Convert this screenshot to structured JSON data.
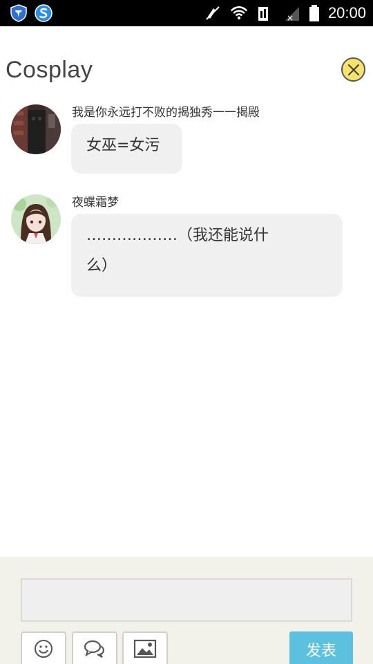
{
  "status_bar": {
    "time": "20:00",
    "icons": [
      "shield-app-icon",
      "sogou-app-icon",
      "mute-icon",
      "wifi-icon",
      "data-icon",
      "signal-icon",
      "battery-icon"
    ]
  },
  "header": {
    "title": "Cosplay",
    "close_icon": "close-icon",
    "close_color": "#f6e46a"
  },
  "messages": [
    {
      "username": "我是你永远打不败的揭独秀一一揭殿",
      "text": "女巫=女污",
      "avatar": "dark-avatar"
    },
    {
      "username": "夜蝶霜梦",
      "text_line1": "………………（我还能说什",
      "text_line2": "么）",
      "avatar": "anime-girl-avatar"
    }
  ],
  "composer": {
    "input_value": "",
    "tools": [
      "emoji-icon",
      "chat-bubbles-icon",
      "image-icon"
    ],
    "send_label": "发表",
    "accent": "#5cc0df"
  }
}
